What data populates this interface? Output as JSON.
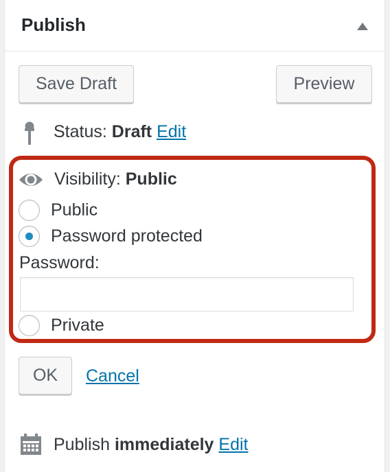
{
  "box": {
    "title": "Publish"
  },
  "actions": {
    "save_draft": "Save Draft",
    "preview": "Preview"
  },
  "status": {
    "label": "Status:",
    "value": "Draft",
    "edit": "Edit"
  },
  "visibility": {
    "label": "Visibility:",
    "value": "Public",
    "options": {
      "public": "Public",
      "password_protected": "Password protected",
      "private": "Private"
    },
    "selected": "password_protected",
    "password_label": "Password:",
    "password_value": ""
  },
  "visibility_actions": {
    "ok": "OK",
    "cancel": "Cancel"
  },
  "publish": {
    "label": "Publish",
    "value": "immediately",
    "edit": "Edit"
  },
  "colors": {
    "link": "#0073aa",
    "highlight": "#c02913",
    "radio_checked": "#1e8cbe"
  },
  "icons": {
    "toggle": "triangle-up-icon",
    "status": "pin-icon",
    "visibility": "eye-icon",
    "publish": "calendar-icon"
  }
}
